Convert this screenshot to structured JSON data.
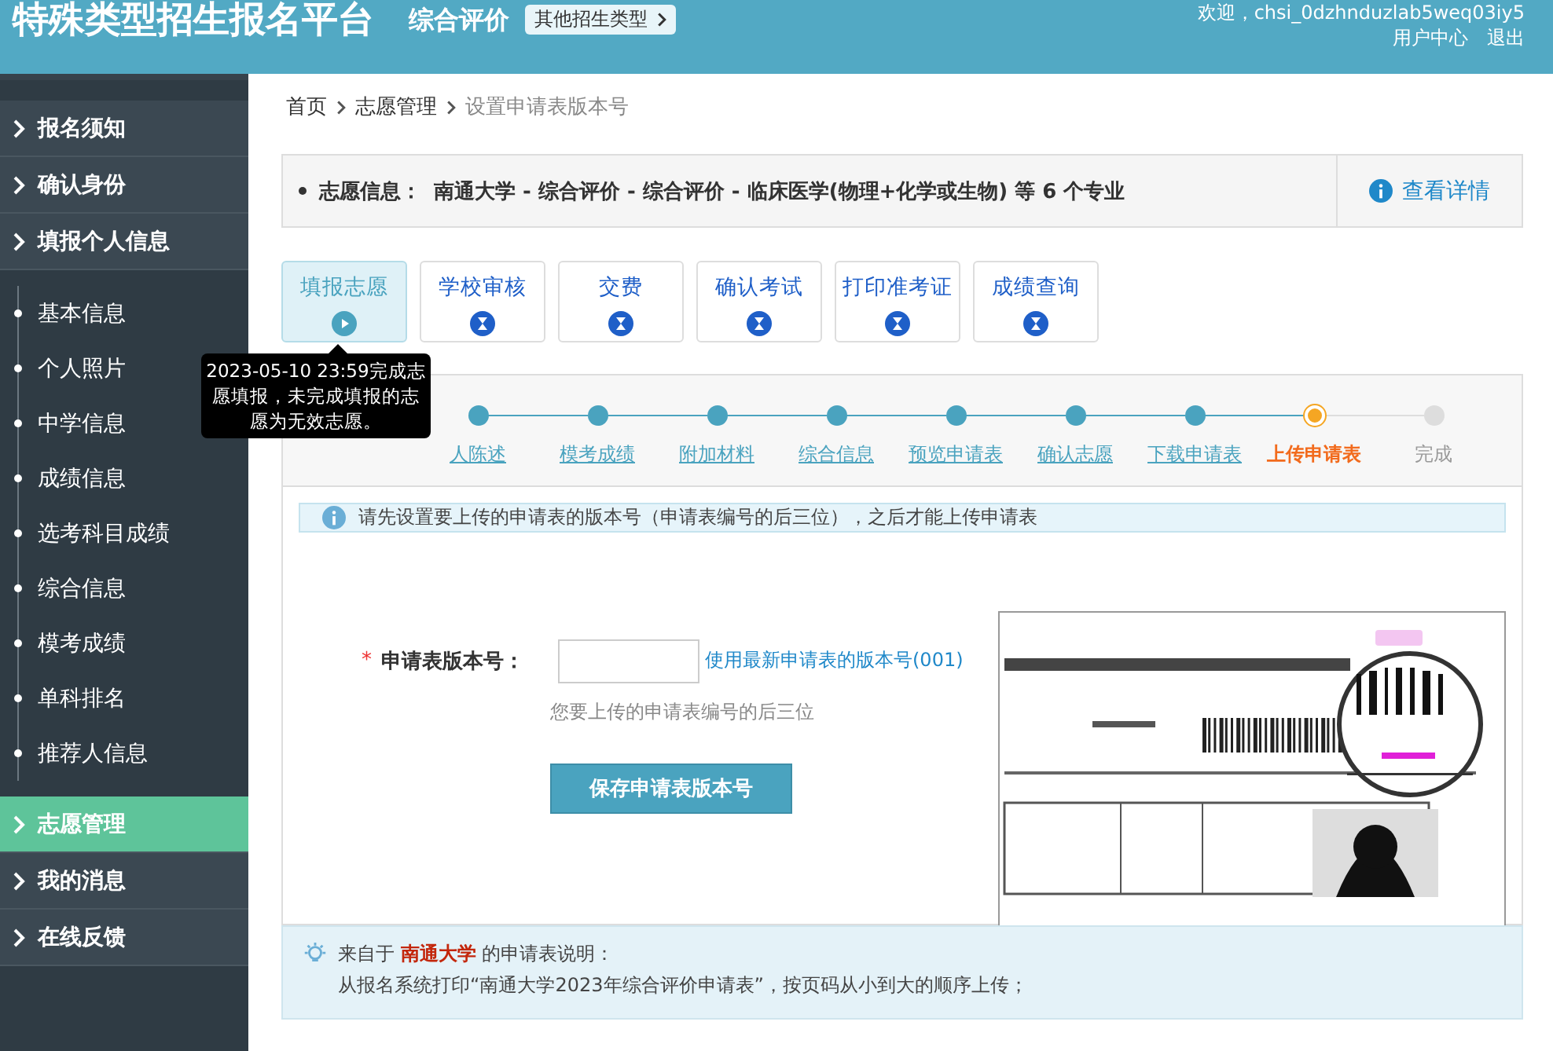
{
  "header": {
    "title": "特殊类型招生报名平台",
    "subtitle": "综合评价",
    "type_button": "其他招生类型",
    "welcome": "欢迎，chsi_0dzhnduzlab5weq03iy5",
    "links": [
      "用户中心",
      "退出"
    ]
  },
  "sidebar": {
    "items": [
      {
        "label": "报名须知",
        "selected": false
      },
      {
        "label": "确认身份",
        "selected": false
      },
      {
        "label": "填报个人信息",
        "selected": false,
        "children": [
          {
            "label": "基本信息"
          },
          {
            "label": "个人照片"
          },
          {
            "label": "中学信息"
          },
          {
            "label": "成绩信息"
          },
          {
            "label": "选考科目成绩"
          },
          {
            "label": "综合信息"
          },
          {
            "label": "模考成绩"
          },
          {
            "label": "单科排名"
          },
          {
            "label": "推荐人信息"
          }
        ]
      },
      {
        "label": "志愿管理",
        "selected": true
      },
      {
        "label": "我的消息",
        "selected": false
      },
      {
        "label": "在线反馈",
        "selected": false
      }
    ]
  },
  "breadcrumb": [
    "首页",
    "志愿管理",
    "设置申请表版本号"
  ],
  "info_bar": {
    "label": "志愿信息：",
    "text": "南通大学 - 综合评价 - 综合评价 - 临床医学(物理+化学或生物) 等 6 个专业",
    "link": "查看详情"
  },
  "process_tabs": [
    {
      "label": "填报志愿",
      "selected": true
    },
    {
      "label": "学校审核",
      "selected": false
    },
    {
      "label": "交费",
      "selected": false
    },
    {
      "label": "确认考试",
      "selected": false
    },
    {
      "label": "打印准考证",
      "selected": false
    },
    {
      "label": "成绩查询",
      "selected": false
    }
  ],
  "tooltip": "2023-05-10 23:59完成志愿填报，未完成填报的志愿为无效志愿。",
  "steps": [
    {
      "label": "人陈述",
      "done": true,
      "selected": false
    },
    {
      "label": "模考成绩",
      "done": true,
      "selected": false
    },
    {
      "label": "附加材料",
      "done": true,
      "selected": false
    },
    {
      "label": "综合信息",
      "done": true,
      "selected": false
    },
    {
      "label": "预览申请表",
      "done": true,
      "selected": false
    },
    {
      "label": "确认志愿",
      "done": true,
      "selected": false
    },
    {
      "label": "下载申请表",
      "done": true,
      "selected": false
    },
    {
      "label": "上传申请表",
      "done": false,
      "selected": true
    },
    {
      "label": "完成",
      "done": false,
      "selected": false
    }
  ],
  "notice": "请先设置要上传的申请表的版本号（申请表编号的后三位），之后才能上传申请表",
  "form": {
    "required_mark": "*",
    "label": "申请表版本号：",
    "link": "使用最新申请表的版本号(001)",
    "hint": "您要上传的申请表编号的后三位",
    "button": "保存申请表版本号"
  },
  "note": {
    "prefix": "来自于",
    "school": "南通大学",
    "suffix": "的申请表说明：",
    "body": "从报名系统打印“南通大学2023年综合评价申请表”，按页码从小到大的顺序上传；"
  }
}
